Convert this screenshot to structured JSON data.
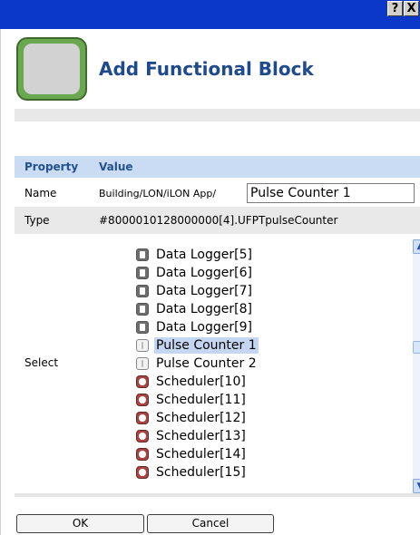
{
  "titlebar": {
    "help_label": "?",
    "close_label": "X"
  },
  "dialog": {
    "title": "Add Functional Block",
    "logo_icon": "functional-block-icon"
  },
  "table": {
    "headers": {
      "property": "Property",
      "value": "Value"
    },
    "name_row": {
      "label": "Name",
      "path": "Building/LON/iLON App/",
      "input_value": "Pulse Counter 1"
    },
    "type_row": {
      "label": "Type",
      "value": "#8000010128000000[4].UFPTpulseCounter"
    },
    "select_row": {
      "label": "Select",
      "items": [
        {
          "label": "Data Logger[5]",
          "icon": "data-logger-icon",
          "selected": false
        },
        {
          "label": "Data Logger[6]",
          "icon": "data-logger-icon",
          "selected": false
        },
        {
          "label": "Data Logger[7]",
          "icon": "data-logger-icon",
          "selected": false
        },
        {
          "label": "Data Logger[8]",
          "icon": "data-logger-icon",
          "selected": false
        },
        {
          "label": "Data Logger[9]",
          "icon": "data-logger-icon",
          "selected": false
        },
        {
          "label": "Pulse Counter 1",
          "icon": "pulse-counter-icon",
          "selected": true
        },
        {
          "label": "Pulse Counter 2",
          "icon": "pulse-counter-icon",
          "selected": false
        },
        {
          "label": "Scheduler[10]",
          "icon": "scheduler-icon",
          "selected": false
        },
        {
          "label": "Scheduler[11]",
          "icon": "scheduler-icon",
          "selected": false
        },
        {
          "label": "Scheduler[12]",
          "icon": "scheduler-icon",
          "selected": false
        },
        {
          "label": "Scheduler[13]",
          "icon": "scheduler-icon",
          "selected": false
        },
        {
          "label": "Scheduler[14]",
          "icon": "scheduler-icon",
          "selected": false
        },
        {
          "label": "Scheduler[15]",
          "icon": "scheduler-icon",
          "selected": false
        }
      ]
    }
  },
  "buttons": {
    "ok": "OK",
    "cancel": "Cancel"
  },
  "colors": {
    "titlebar": "#0b38c8",
    "header_bg": "#c9dcf3",
    "heading": "#1f4a8c",
    "selection": "#c5d6f2"
  }
}
